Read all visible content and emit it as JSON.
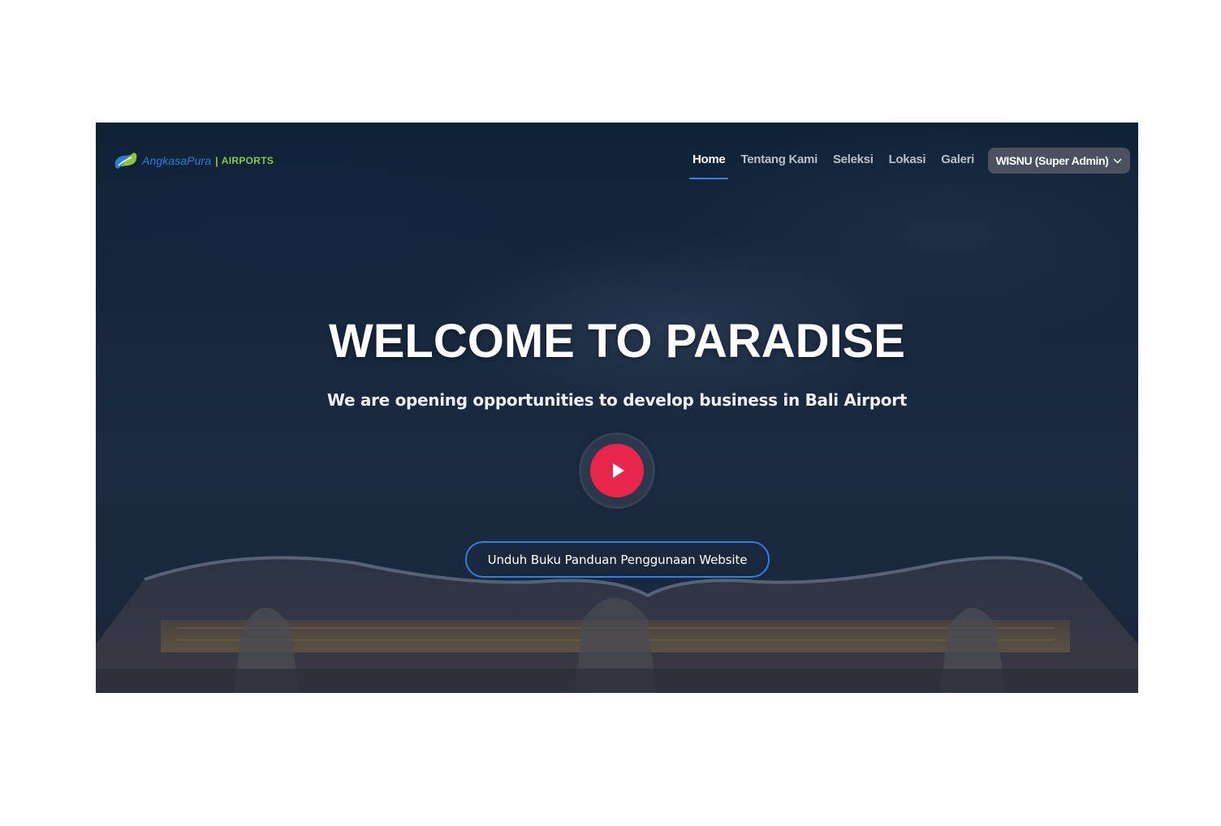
{
  "brand": {
    "name": "AngkasaPura",
    "separator": "|",
    "sub": "AIRPORTS",
    "logo_icon": "angkasa-pura-logo-icon"
  },
  "nav": {
    "items": [
      {
        "label": "Home",
        "active": true
      },
      {
        "label": "Tentang Kami",
        "active": false
      },
      {
        "label": "Seleksi",
        "active": false
      },
      {
        "label": "Lokasi",
        "active": false
      },
      {
        "label": "Galeri",
        "active": false
      }
    ],
    "user": {
      "label": "WISNU (Super Admin)",
      "icon": "chevron-down-icon"
    }
  },
  "hero": {
    "title": "WELCOME TO PARADISE",
    "subtitle": "We are opening opportunities to develop business in Bali Airport",
    "play_icon": "play-icon",
    "guide_button": "Unduh Buku Panduan Penggunaan Website"
  },
  "colors": {
    "accent": "#3b82e8",
    "play": "#e8254a",
    "user_menu_bg": "#4b5160",
    "logo_blue": "#2a7fd4",
    "logo_green": "#8cc63f"
  }
}
